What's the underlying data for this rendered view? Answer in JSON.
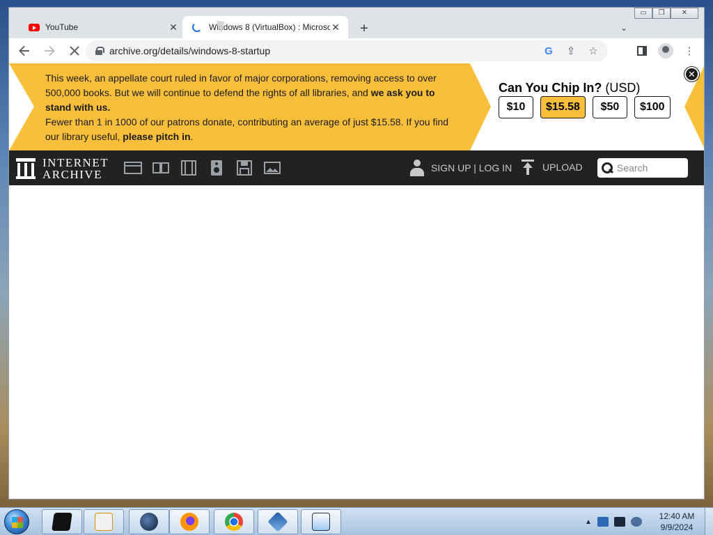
{
  "browser": {
    "tabs": [
      {
        "title": "YouTube",
        "favicon": "youtube-icon",
        "active": false
      },
      {
        "title": "Windows 8 (VirtualBox) : Microso",
        "favicon": "loading-spinner-icon",
        "active": true
      }
    ],
    "new_tab_label": "+",
    "tab_search_label": "⌄",
    "url": "archive.org/details/windows-8-startup",
    "window_controls": {
      "minimize": "▭",
      "restore": "❐",
      "close": "✕"
    }
  },
  "banner": {
    "line1": "This week, an appellate court ruled in favor of major corporations, removing access to over 500,000 books. But we will continue to defend the rights of all libraries, and ",
    "line1_bold": "we ask you to stand with us.",
    "line2": "Fewer than 1 in 1000 of our patrons donate, contributing an average of just $15.58. If you find our library useful, ",
    "line2_bold": "please pitch in",
    "line2_end": ".",
    "chip_title": "Can You Chip In?",
    "chip_currency": "(USD)",
    "amounts": [
      "$10",
      "$15.58",
      "$50",
      "$100"
    ],
    "selected_amount": "$15.58",
    "close_label": "✕",
    "accent_color": "#f9bf3b"
  },
  "ia_nav": {
    "logo_line1": "INTERNET",
    "logo_line2": "ARCHIVE",
    "media_icons": [
      "web-icon",
      "texts-icon",
      "video-icon",
      "audio-icon",
      "software-icon",
      "images-icon"
    ],
    "sign_up_login": "SIGN UP | LOG IN",
    "upload": "UPLOAD",
    "search_placeholder": "Search"
  },
  "taskbar": {
    "apps": [
      "desktop-app-icon",
      "media-player-icon",
      "app-globe-icon",
      "firefox-icon",
      "chrome-icon",
      "virtualbox-icon",
      "win7-app-icon"
    ],
    "time": "12:40 AM",
    "date": "9/9/2024"
  }
}
